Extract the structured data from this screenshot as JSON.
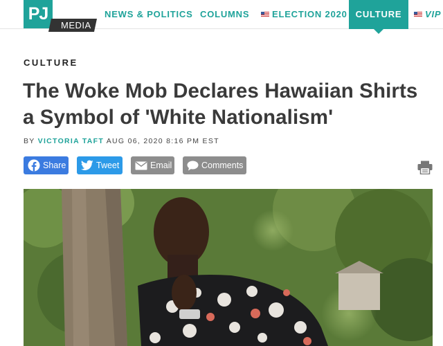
{
  "logo": {
    "primary": "PJ",
    "secondary": "MEDIA"
  },
  "nav": {
    "items": [
      {
        "label": "NEWS & POLITICS"
      },
      {
        "label": "COLUMNS"
      },
      {
        "label": "ELECTION 2020",
        "icon": "us-flag-icon"
      },
      {
        "label": "CULTURE",
        "active": true
      },
      {
        "label": "VIP",
        "icon": "us-flag-icon"
      }
    ],
    "accent_color": "#1fa39a"
  },
  "article": {
    "section": "CULTURE",
    "title_line1": "The Woke Mob Declares Hawaiian Shirts",
    "title_line2": "a Symbol of 'White Nationalism'",
    "byline_prefix": "BY",
    "author": "VICTORIA TAFT",
    "date": "AUG 06, 2020 8:16 PM EST"
  },
  "share": {
    "facebook": "Share",
    "twitter": "Tweet",
    "email": "Email",
    "comments": "Comments"
  },
  "hero_image": {
    "alt": "photo"
  }
}
